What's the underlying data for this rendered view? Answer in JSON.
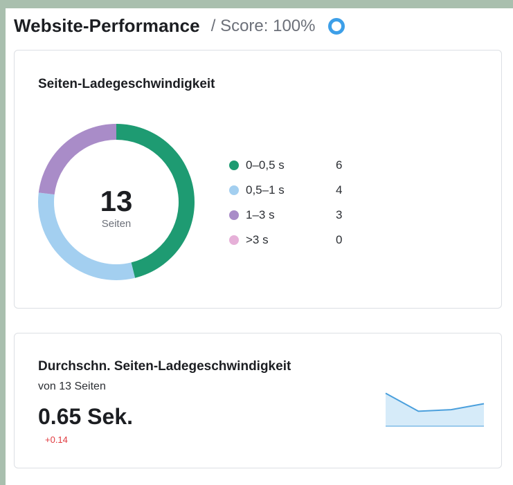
{
  "header": {
    "title": "Website-Performance",
    "score": "/ Score: 100%",
    "score_icon": "ring-icon",
    "score_icon_color": "#3d9fe8"
  },
  "load_speed_card": {
    "title": "Seiten-Ladegeschwindigkeit",
    "total": "13",
    "total_label": "Seiten",
    "legend": [
      {
        "label": "0–0,5 s",
        "value": "6",
        "color": "#1e9b72"
      },
      {
        "label": "0,5–1 s",
        "value": "4",
        "color": "#a3cff0"
      },
      {
        "label": "1–3 s",
        "value": "3",
        "color": "#a98cc8"
      },
      {
        "label": ">3 s",
        "value": "0",
        "color": "#e6b0d8"
      }
    ]
  },
  "avg_speed_card": {
    "title": "Durchschn. Seiten-Ladegeschwindigkeit",
    "subtitle": "von 13 Seiten",
    "value": "0.65 Sek.",
    "delta": "+0.14",
    "delta_color": "#e0393e",
    "sparkline_color": "#4a9fdc",
    "sparkline_fill": "#d6ebf9"
  },
  "chart_data": [
    {
      "type": "pie",
      "title": "Seiten-Ladegeschwindigkeit",
      "categories": [
        "0–0,5 s",
        "0,5–1 s",
        "1–3 s",
        ">3 s"
      ],
      "values": [
        6,
        4,
        3,
        0
      ],
      "colors": [
        "#1e9b72",
        "#a3cff0",
        "#a98cc8",
        "#e6b0d8"
      ],
      "legend": "right"
    },
    {
      "type": "area",
      "values": [
        0.72,
        0.6,
        0.61,
        0.65
      ]
    }
  ]
}
